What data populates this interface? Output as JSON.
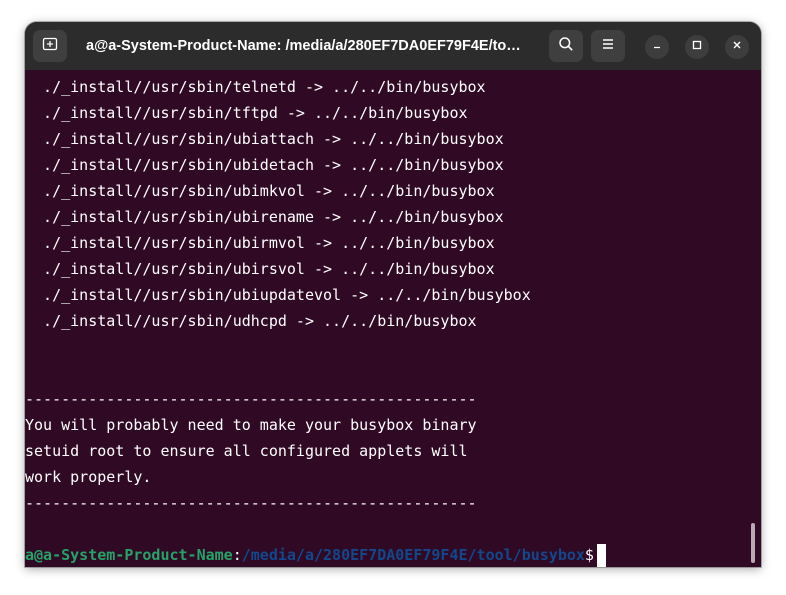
{
  "window": {
    "title": "a@a-System-Product-Name: /media/a/280EF7DA0EF79F4E/to…"
  },
  "titlebar": {
    "new_tab_icon": "new-tab-icon",
    "search_icon": "search-icon",
    "menu_icon": "hamburger-menu-icon",
    "minimize_icon": "minimize-icon",
    "maximize_icon": "maximize-icon",
    "close_icon": "close-icon"
  },
  "terminal": {
    "install_lines": [
      "  ./_install//usr/sbin/telnetd -> ../../bin/busybox",
      "  ./_install//usr/sbin/tftpd -> ../../bin/busybox",
      "  ./_install//usr/sbin/ubiattach -> ../../bin/busybox",
      "  ./_install//usr/sbin/ubidetach -> ../../bin/busybox",
      "  ./_install//usr/sbin/ubimkvol -> ../../bin/busybox",
      "  ./_install//usr/sbin/ubirename -> ../../bin/busybox",
      "  ./_install//usr/sbin/ubirmvol -> ../../bin/busybox",
      "  ./_install//usr/sbin/ubirsvol -> ../../bin/busybox",
      "  ./_install//usr/sbin/ubiupdatevol -> ../../bin/busybox",
      "  ./_install//usr/sbin/udhcpd -> ../../bin/busybox"
    ],
    "separator": "--------------------------------------------------",
    "message_lines": [
      "You will probably need to make your busybox binary",
      "setuid root to ensure all configured applets will",
      "work properly."
    ],
    "prompt": {
      "user_host": "a@a-System-Product-Name",
      "colon": ":",
      "path": "/media/a/280EF7DA0EF79F4E/tool/busybox",
      "dollar": "$"
    }
  },
  "colors": {
    "terminal_bg": "#300a24",
    "titlebar_bg": "#2c2c2c",
    "prompt_user": "#26a269",
    "prompt_path": "#12488b"
  }
}
